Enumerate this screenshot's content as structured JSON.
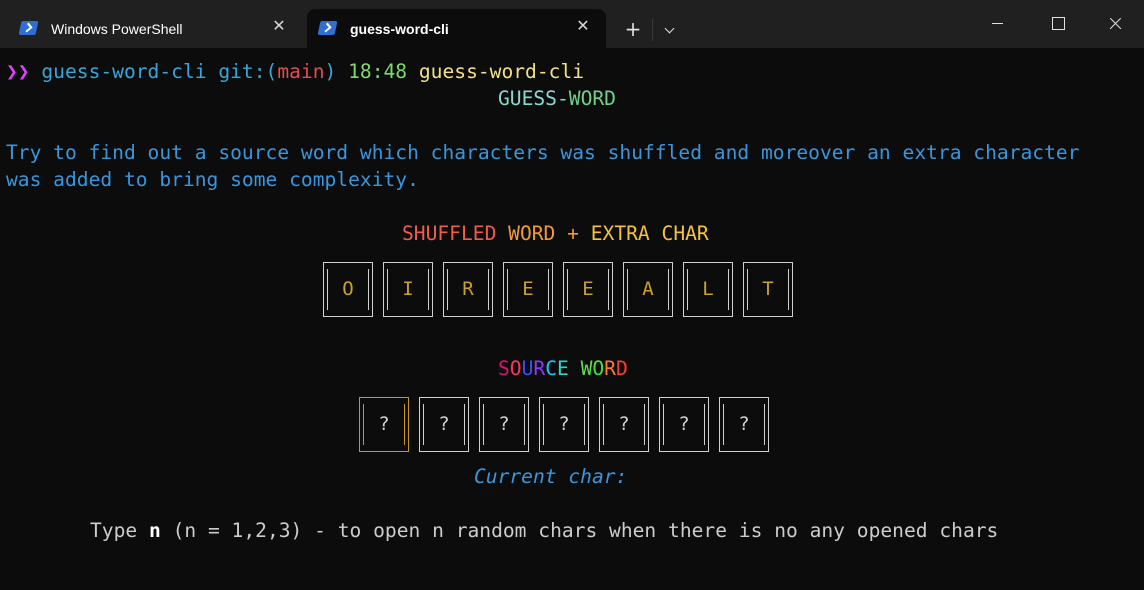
{
  "tabs": [
    {
      "label": "Windows PowerShell",
      "icon": "powershell-icon",
      "active": false
    },
    {
      "label": "guess-word-cli",
      "icon": "powershell-icon",
      "active": true
    }
  ],
  "tab_controls": {
    "new_tab": "+",
    "close": "✕"
  },
  "prompt": {
    "arrows": "❯❯",
    "dir": "guess-word-cli",
    "git": "git:(",
    "branch": "main",
    "git_close": ")",
    "time": "18:48",
    "command": "guess-word-cli"
  },
  "game": {
    "title_part1": "GUESS-",
    "title_part2": "WORD",
    "intro_line1": "Try to find out a source word which characters was shuffled and moreover an extra character",
    "intro_line2": "was added to bring some complexity.",
    "shuffled_heading": {
      "shuffled": "SHUFFLED",
      "word": "WORD",
      "plus": "+",
      "extra": "EXTRA CHAR"
    },
    "shuffled_letters": [
      "O",
      "I",
      "R",
      "E",
      "E",
      "A",
      "L",
      "T"
    ],
    "source_heading": [
      "S",
      "O",
      "U",
      "R",
      "C",
      "E",
      " ",
      "W",
      "O",
      "R",
      "D"
    ],
    "source_slots": [
      "?",
      "?",
      "?",
      "?",
      "?",
      "?",
      "?"
    ],
    "current_char_label": "Current char:",
    "hint_prefix": "Type ",
    "hint_n": "n",
    "hint_suffix": " (n = 1,2,3) - to open n random chars when there is no any opened chars"
  },
  "colors": {
    "background": "#0c0c0c",
    "titlebar": "#202020",
    "intro_blue": "#3a96dd",
    "letter_gold": "#c9a227",
    "current_box": "#c8961e"
  }
}
